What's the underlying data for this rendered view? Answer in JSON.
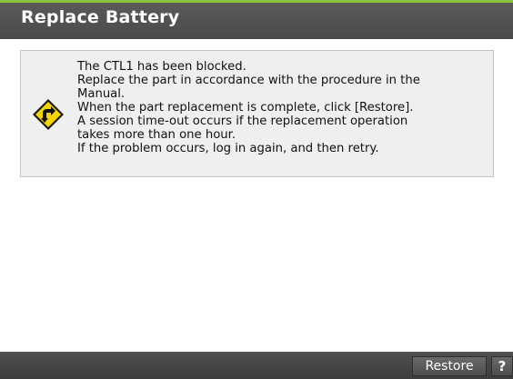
{
  "dialog": {
    "title": "Replace Battery"
  },
  "message": {
    "icon": "warning-diamond-icon",
    "lines": [
      "The CTL1 has been blocked.",
      "Replace the part in accordance with the procedure in the",
      "Manual.",
      "When the part replacement is complete, click [Restore].",
      "A session time-out occurs if the replacement operation",
      "takes more than one hour.",
      "If the problem occurs, log in again, and then retry."
    ]
  },
  "footer": {
    "restore_label": "Restore",
    "help_label": "?"
  },
  "colors": {
    "accent": "#8cc63f",
    "warning_fill": "#f5d400",
    "titlebar": "#4a4a4a"
  }
}
